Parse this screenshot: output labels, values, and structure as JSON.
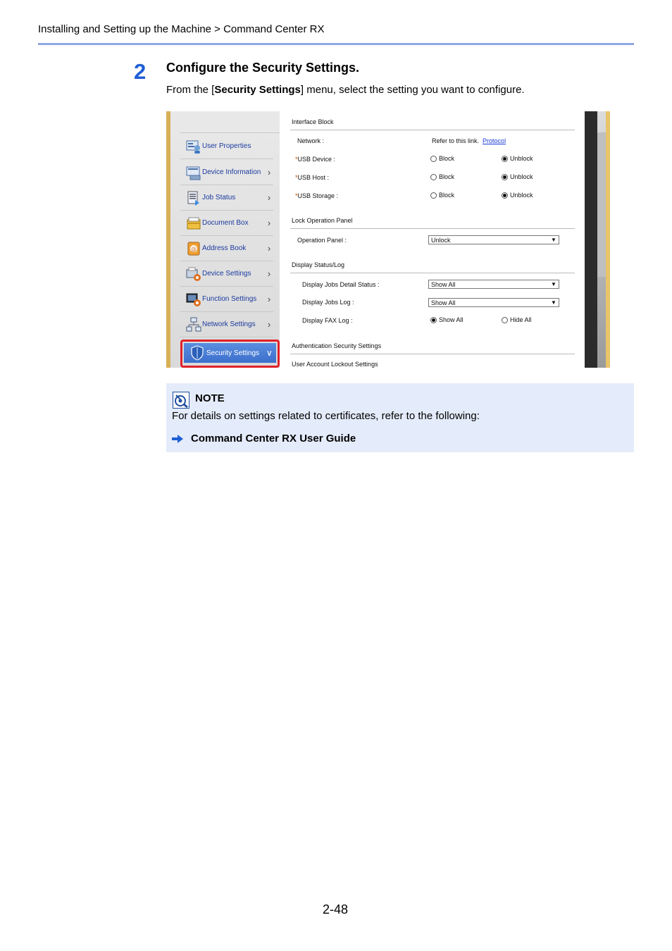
{
  "header": {
    "breadcrumb": "Installing and Setting up the Machine > Command Center RX"
  },
  "step": {
    "number": "2",
    "title": "Configure the Security Settings.",
    "desc_pre": "From the [",
    "desc_bold": "Security Settings",
    "desc_post": "] menu, select the setting you want to configure."
  },
  "sidebar": {
    "items": [
      {
        "label": "User Properties",
        "icon": "user-properties-icon"
      },
      {
        "label": "Device Information",
        "icon": "device-information-icon"
      },
      {
        "label": "Job Status",
        "icon": "job-status-icon"
      },
      {
        "label": "Document Box",
        "icon": "document-box-icon"
      },
      {
        "label": "Address Book",
        "icon": "address-book-icon"
      },
      {
        "label": "Device Settings",
        "icon": "device-settings-icon"
      },
      {
        "label": "Function Settings",
        "icon": "function-settings-icon"
      },
      {
        "label": "Network Settings",
        "icon": "network-settings-icon"
      }
    ],
    "selected": {
      "label": "Security Settings",
      "icon": "shield-icon"
    }
  },
  "content": {
    "interface_block": {
      "title": "Interface Block",
      "network_label": "Network :",
      "network_text": "Refer to this link.",
      "network_link": "Protocol",
      "required_mark": "*",
      "usb_device_label": "USB Device :",
      "usb_host_label": "USB Host :",
      "usb_storage_label": "USB Storage :",
      "block": "Block",
      "unblock": "Unblock"
    },
    "lock_panel": {
      "title": "Lock Operation Panel",
      "label": "Operation Panel :",
      "value": "Unlock"
    },
    "display_status": {
      "title": "Display Status/Log",
      "jobs_detail_label": "Display Jobs Detail Status :",
      "jobs_detail_value": "Show All",
      "jobs_log_label": "Display Jobs Log :",
      "jobs_log_value": "Show All",
      "fax_log_label": "Display FAX Log :",
      "fax_show": "Show All",
      "fax_hide": "Hide All"
    },
    "auth_title": "Authentication Security Settings",
    "lockout_title": "User Account Lockout Settings"
  },
  "note": {
    "title": "NOTE",
    "body": "For details on settings related to certificates, refer to the following:",
    "link": "Command Center RX User Guide"
  },
  "page_number": "2-48",
  "colors": {
    "accent_blue": "#1f5fd6",
    "rule_blue": "#8ea8e0",
    "note_bg": "#e4ebfa",
    "highlight_red": "#e0202a"
  }
}
